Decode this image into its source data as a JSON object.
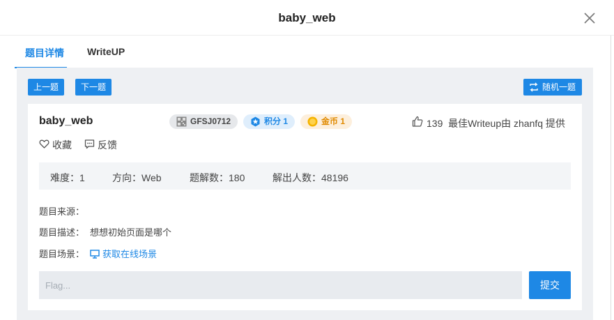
{
  "dialog": {
    "title": "baby_web",
    "close_icon": "close-icon"
  },
  "tabs": [
    {
      "label": "题目详情",
      "active": true
    },
    {
      "label": "WriteUP",
      "active": false
    }
  ],
  "nav": {
    "prev_label": "上一题",
    "next_label": "下一题",
    "random_label": "随机一题",
    "random_icon": "shuffle-icon"
  },
  "challenge": {
    "name": "baby_web",
    "code_badge": "GFSJ0712",
    "score_badge": "积分 1",
    "coin_badge": "金币 1",
    "likes": "139",
    "writeup_text": "最佳Writeup由 zhanfq 提供",
    "favorite_label": "收藏",
    "feedback_label": "反馈"
  },
  "stats": {
    "difficulty": "难度：1",
    "direction": "方向：Web",
    "solves_count": "题解数：180",
    "solvers": "解出人数：48196"
  },
  "info": {
    "source_label": "题目来源：",
    "source_value": "",
    "desc_label": "题目描述：",
    "desc_value": "想想初始页面是哪个",
    "scene_label": "题目场景：",
    "scene_link": "获取在线场景"
  },
  "flag": {
    "placeholder": "Flag...",
    "submit_label": "提交"
  },
  "colors": {
    "accent": "#1e88e5",
    "panel_bg": "#eef0f3",
    "coin": "#e08a00"
  }
}
